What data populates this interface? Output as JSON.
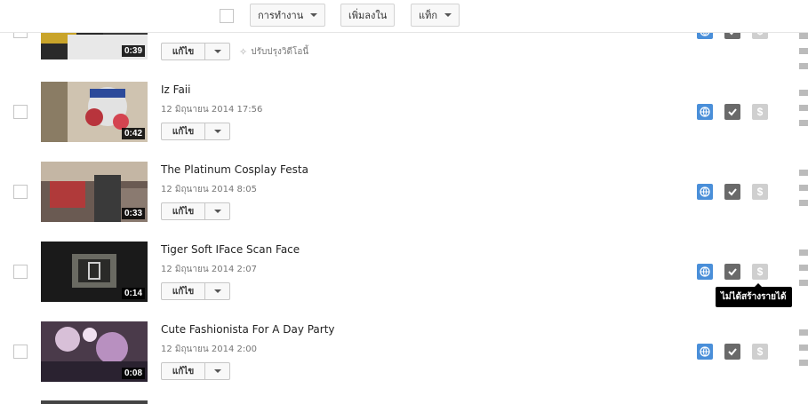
{
  "toolbar": {
    "actions_label": "การทำงาน",
    "add_to_label": "เพิ่มลงใน",
    "tags_label": "แท็ก"
  },
  "videos": [
    {
      "title": "",
      "date": "",
      "duration": "0:39",
      "edit_label": "แก้ไข",
      "enhance_label": "ปรับปรุงวิดีโอนี้"
    },
    {
      "title": "Iz Faii",
      "date": "12 มิถุนายน 2014 17:56",
      "duration": "0:42",
      "edit_label": "แก้ไข"
    },
    {
      "title": "The Platinum Cosplay Festa",
      "date": "12 มิถุนายน 2014 8:05",
      "duration": "0:33",
      "edit_label": "แก้ไข"
    },
    {
      "title": "Tiger Soft IFace Scan Face",
      "date": "12 มิถุนายน 2014 2:07",
      "duration": "0:14",
      "edit_label": "แก้ไข"
    },
    {
      "title": "Cute Fashionista For A Day Party",
      "date": "12 มิถุนายน 2014 2:00",
      "duration": "0:08",
      "edit_label": "แก้ไข"
    }
  ],
  "monetization_symbol": "$",
  "tooltip": "ไม่ได้สร้างรายได้",
  "colors": {
    "public": "#4a8fd9",
    "checked": "#6a6a6a",
    "money": "#cfcfcf"
  }
}
